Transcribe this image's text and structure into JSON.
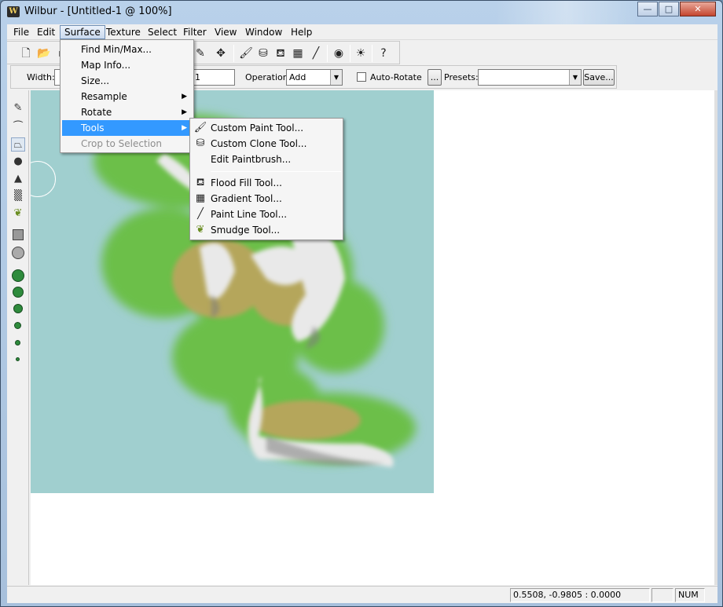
{
  "window": {
    "title": "Wilbur - [Untitled-1 @ 100%]",
    "icon_letter": "W"
  },
  "titlebar_buttons": {
    "minimize": "—",
    "maximize": "□",
    "close": "✕"
  },
  "menubar": [
    "File",
    "Edit",
    "Surface",
    "Texture",
    "Select",
    "Filter",
    "View",
    "Window",
    "Help"
  ],
  "menubar_active": "Surface",
  "toolbar1": {
    "icons": [
      "new-file-icon",
      "open-folder-icon",
      "save-icon",
      "brush-icon",
      "move-icon",
      "paint-brush-icon",
      "clone-stamp-icon",
      "flood-fill-icon",
      "gradient-icon",
      "paint-line-icon",
      "render-globe-icon",
      "light-icon",
      "help-icon"
    ]
  },
  "toolbar2": {
    "width_label": "Width:",
    "width_value": "",
    "second_value": "1",
    "operation_label": "Operation:",
    "operation_value": "Add",
    "auto_rotate_label": "Auto-Rotate",
    "auto_rotate_checked": false,
    "ellipsis_label": "...",
    "presets_label": "Presets:",
    "presets_value": "",
    "save_label": "Save..."
  },
  "surface_menu": [
    {
      "label": "Find Min/Max...",
      "submenu": false,
      "disabled": false
    },
    {
      "label": "Map Info...",
      "submenu": false,
      "disabled": false
    },
    {
      "label": "Size...",
      "submenu": false,
      "disabled": false
    },
    {
      "label": "Resample",
      "submenu": true,
      "disabled": false
    },
    {
      "label": "Rotate",
      "submenu": true,
      "disabled": false
    },
    {
      "label": "Tools",
      "submenu": true,
      "disabled": false,
      "highlighted": true
    },
    {
      "label": "Crop to Selection",
      "submenu": false,
      "disabled": true
    }
  ],
  "tools_submenu": {
    "group1": [
      {
        "label": "Custom Paint Tool...",
        "icon": "paint-brush-icon"
      },
      {
        "label": "Custom Clone Tool...",
        "icon": "clone-stamp-icon"
      },
      {
        "label": "Edit Paintbrush...",
        "icon": ""
      }
    ],
    "group2": [
      {
        "label": "Flood Fill Tool...",
        "icon": "flood-fill-icon"
      },
      {
        "label": "Gradient Tool...",
        "icon": "gradient-icon"
      },
      {
        "label": "Paint Line Tool...",
        "icon": "paint-line-icon"
      },
      {
        "label": "Smudge Tool...",
        "icon": "smudge-icon"
      }
    ]
  },
  "statusbar": {
    "coords": "0.5508, -0.9805 : 0.0000",
    "num": "NUM"
  },
  "colors": {
    "menu_highlight": "#3399ff",
    "map_water": "#a0cfcf",
    "brush_green": "#2e8b3c"
  }
}
